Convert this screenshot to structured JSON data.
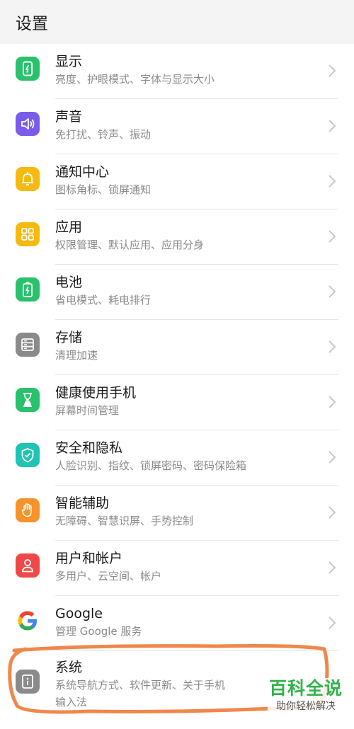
{
  "header": {
    "title": "设置"
  },
  "items": [
    {
      "title": "显示",
      "sub": "亮度、护眼模式、字体与显示大小",
      "icon": "display-icon",
      "color": "#27c26b"
    },
    {
      "title": "声音",
      "sub": "免打扰、铃声、振动",
      "icon": "sound-icon",
      "color": "#7a5bea"
    },
    {
      "title": "通知中心",
      "sub": "图标角标、锁屏通知",
      "icon": "bell-icon",
      "color": "#f5b90f"
    },
    {
      "title": "应用",
      "sub": "权限管理、默认应用、应用分身",
      "icon": "apps-icon",
      "color": "#f5b90f"
    },
    {
      "title": "电池",
      "sub": "省电模式、耗电排行",
      "icon": "battery-icon",
      "color": "#27c26b"
    },
    {
      "title": "存储",
      "sub": "清理加速",
      "icon": "storage-icon",
      "color": "#8a8a8a"
    },
    {
      "title": "健康使用手机",
      "sub": "屏幕时间管理",
      "icon": "hourglass-icon",
      "color": "#27c26b"
    },
    {
      "title": "安全和隐私",
      "sub": "人脸识别、指纹、锁屏密码、密码保险箱",
      "icon": "shield-icon",
      "color": "#1fc4b4"
    },
    {
      "title": "智能辅助",
      "sub": "无障碍、智慧识屏、手势控制",
      "icon": "hand-icon",
      "color": "#f7932b"
    },
    {
      "title": "用户和帐户",
      "sub": "多用户、云空间、帐户",
      "icon": "user-icon",
      "color": "#f04848"
    },
    {
      "title": "Google",
      "sub": "管理 Google 服务",
      "icon": "google-icon",
      "color": "#ffffff"
    }
  ],
  "system_item": {
    "title": "系统",
    "sub_line1": "系统导航方式、软件更新、关于手机",
    "sub_line2": "输入法",
    "icon": "info-icon",
    "color": "#8a8a8a"
  },
  "watermark": {
    "big": "百科全说",
    "small": "助你轻松解决"
  },
  "colors": {
    "highlight": "#f0874a",
    "chevron": "#c8c8c8"
  }
}
